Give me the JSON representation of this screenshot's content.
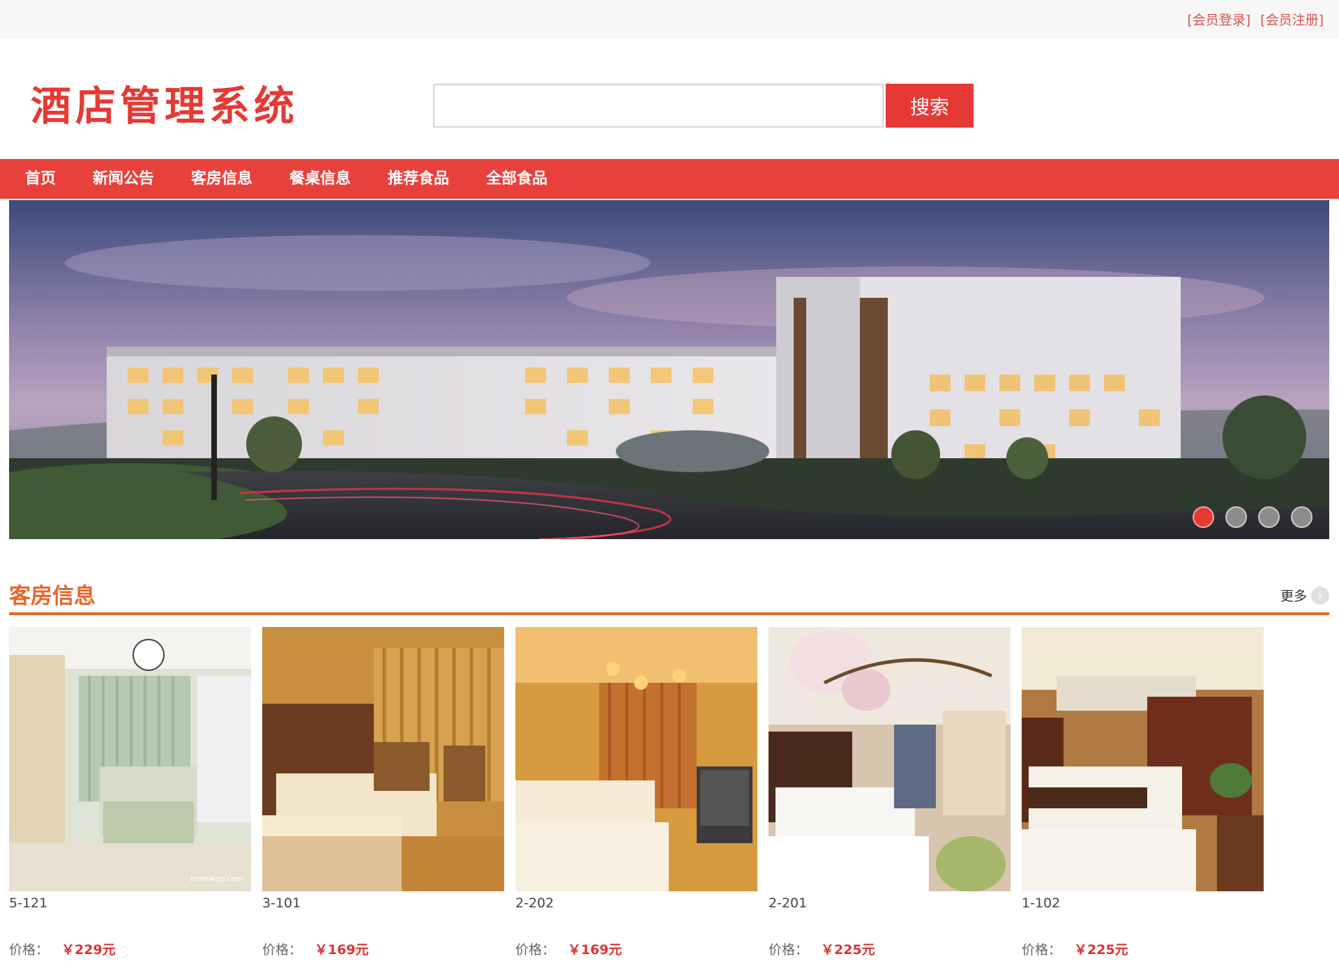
{
  "topbar": {
    "login": "[会员登录]",
    "register": "[会员注册]"
  },
  "header": {
    "site_title": "酒店管理系统",
    "search_placeholder": "",
    "search_value": "",
    "search_button": "搜索"
  },
  "nav": [
    {
      "label": "首页"
    },
    {
      "label": "新闻公告"
    },
    {
      "label": "客房信息"
    },
    {
      "label": "餐桌信息"
    },
    {
      "label": "推荐食品"
    },
    {
      "label": "全部食品"
    }
  ],
  "banner": {
    "slide_count": 4,
    "active_slide": 1
  },
  "rooms_section": {
    "title": "客房信息",
    "more_label": "更多",
    "more_icon": "chevron-right-icon",
    "price_label": "价格：",
    "rooms": [
      {
        "name": "5-121",
        "price": "￥229元",
        "photo_caption": "homekoo.com"
      },
      {
        "name": "3-101",
        "price": "￥169元"
      },
      {
        "name": "2-202",
        "price": "￥169元"
      },
      {
        "name": "2-201",
        "price": "￥225元"
      },
      {
        "name": "1-102",
        "price": "￥225元"
      }
    ]
  },
  "colors": {
    "brand_red": "#e53935",
    "nav_red": "#e8413c",
    "section_orange": "#e6672c",
    "price_red": "#dd3333"
  }
}
